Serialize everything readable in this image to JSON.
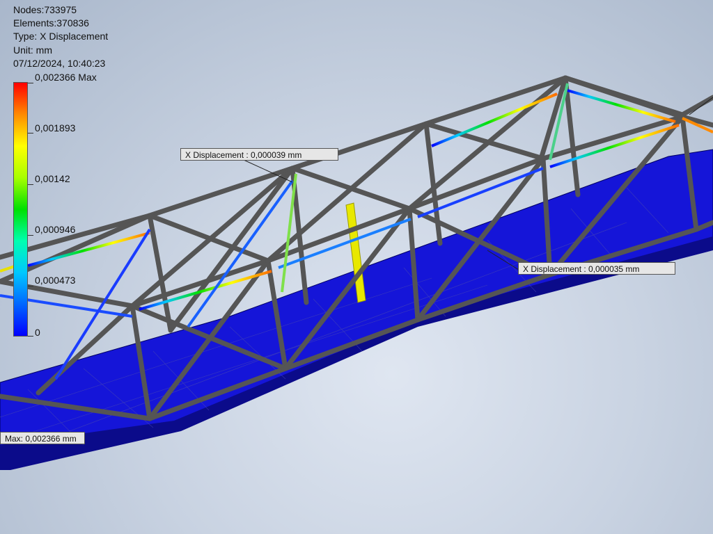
{
  "model_info": {
    "nodes": "Nodes:733975",
    "elements": "Elements:370836",
    "type": "Type: X Displacement",
    "unit": "Unit: mm",
    "timestamp": "07/12/2024, 10:40:23"
  },
  "legend": {
    "colors": [
      "#ff0000",
      "#ff8a00",
      "#ffff00",
      "#a8ff00",
      "#00e000",
      "#00ffb0",
      "#00c8ff",
      "#0066ff",
      "#0000ff"
    ],
    "labels": [
      "0,002366 Max",
      "0,001893",
      "0,00142",
      "0,000946",
      "0,000473",
      "0"
    ]
  },
  "probes": [
    {
      "text": "X Displacement : 0,000039 mm"
    },
    {
      "text": "X Displacement : 0,000035 mm"
    },
    {
      "text": "Max: 0,002366 mm"
    }
  ]
}
